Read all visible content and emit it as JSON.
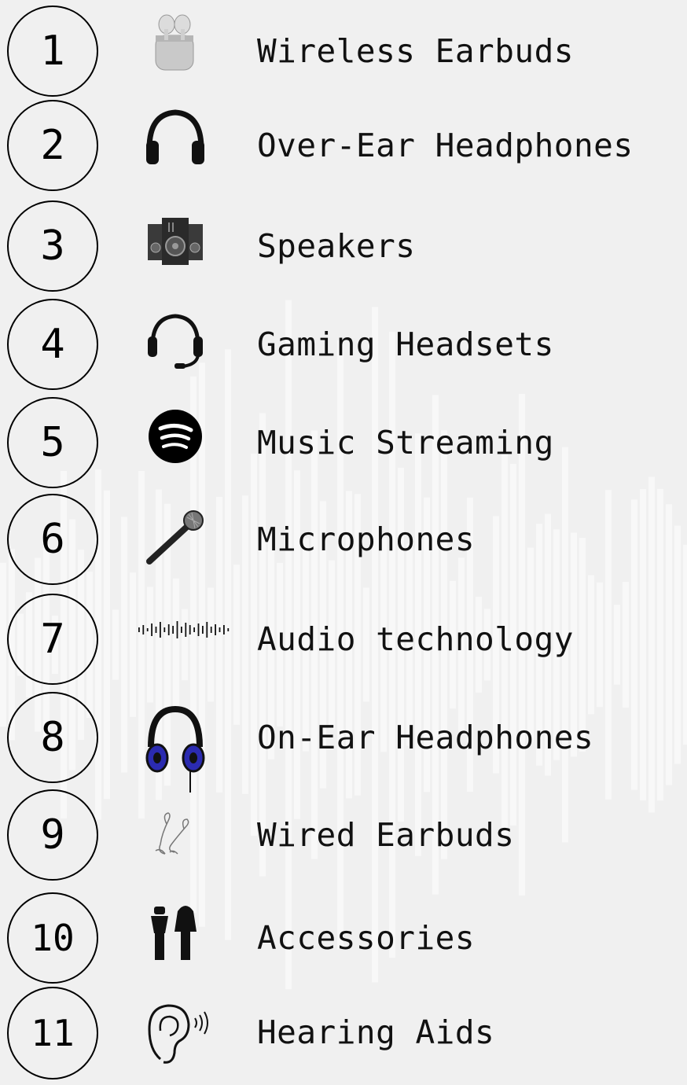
{
  "items": [
    {
      "number": "1",
      "label": "Wireless Earbuds",
      "icon": "earbuds-case-icon"
    },
    {
      "number": "2",
      "label": "Over-Ear Headphones",
      "icon": "over-ear-headphones-icon"
    },
    {
      "number": "3",
      "label": "Speakers",
      "icon": "speakers-icon"
    },
    {
      "number": "4",
      "label": "Gaming Headsets",
      "icon": "headset-icon"
    },
    {
      "number": "5",
      "label": "Music Streaming",
      "icon": "spotify-logo-icon"
    },
    {
      "number": "6",
      "label": "Microphones",
      "icon": "microphone-icon"
    },
    {
      "number": "7",
      "label": "Audio technology",
      "icon": "soundwave-icon"
    },
    {
      "number": "8",
      "label": "On-Ear Headphones",
      "icon": "on-ear-headphones-icon"
    },
    {
      "number": "9",
      "label": "Wired Earbuds",
      "icon": "wired-earbuds-icon"
    },
    {
      "number": "10",
      "label": "Accessories",
      "icon": "ear-plugs-icon"
    },
    {
      "number": "11",
      "label": "Hearing Aids",
      "icon": "ear-icon"
    }
  ],
  "colors": {
    "background": "#f0f0f0",
    "text": "#111111",
    "on_ear_accent": "#2b2bb0"
  }
}
